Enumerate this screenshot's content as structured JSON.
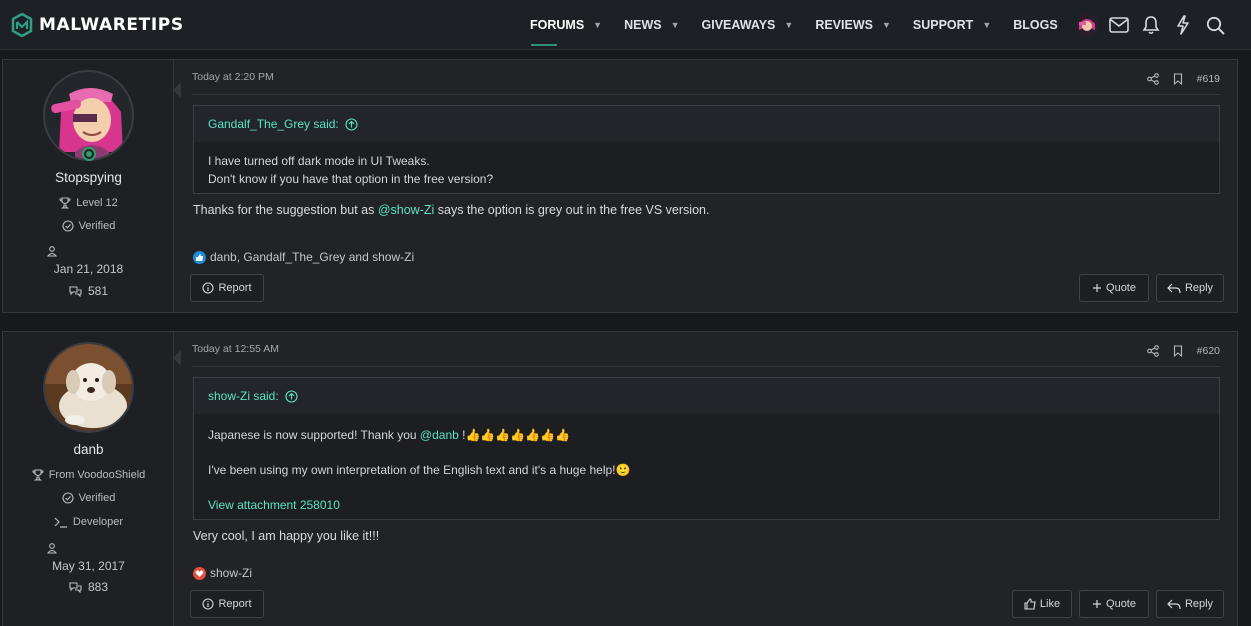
{
  "brand": {
    "name": "MALWARETIPS"
  },
  "nav": [
    {
      "label": "FORUMS",
      "has_menu": true,
      "active": true
    },
    {
      "label": "NEWS",
      "has_menu": true,
      "active": false
    },
    {
      "label": "GIVEAWAYS",
      "has_menu": true,
      "active": false
    },
    {
      "label": "REVIEWS",
      "has_menu": true,
      "active": false
    },
    {
      "label": "SUPPORT",
      "has_menu": true,
      "active": false
    },
    {
      "label": "BLOGS",
      "has_menu": false,
      "active": false
    }
  ],
  "top_icons": [
    "user-avatar",
    "envelope-icon",
    "bell-icon",
    "bolt-icon",
    "search-icon"
  ],
  "colors": {
    "accent": "#5de3c2",
    "brand": "#2f8f7a",
    "online": "#2f9f6a",
    "like": "#1b8fd6",
    "love": "#e0513d"
  },
  "posts": [
    {
      "user": {
        "name": "Stopspying",
        "badges": [
          {
            "icon": "trophy-icon",
            "label": "Level 12"
          },
          {
            "icon": "check-circle-icon",
            "label": "Verified"
          }
        ],
        "joined": "Jan 21, 2018",
        "messages": "581",
        "online": true
      },
      "date": "Today at 2:20 PM",
      "number": "#619",
      "quote": {
        "author_said": "Gandalf_The_Grey said:",
        "lines": [
          "I have turned off dark mode in UI Tweaks.",
          "Don't know if you have that option in the free version?"
        ]
      },
      "text_before": "Thanks for the suggestion but as ",
      "mention": "@show-Zi",
      "text_after": " says the option is grey out in the free VS version.",
      "reactions": "danb, Gandalf_The_Grey and show-Zi",
      "buttons": {
        "report": "Report",
        "quote": "Quote",
        "reply": "Reply"
      }
    },
    {
      "user": {
        "name": "danb",
        "badges": [
          {
            "icon": "trophy-icon",
            "label": "From VoodooShield"
          },
          {
            "icon": "check-circle-icon",
            "label": "Verified"
          },
          {
            "icon": "terminal-icon",
            "label": "Developer"
          }
        ],
        "joined": "May 31, 2017",
        "messages": "883",
        "online": false
      },
      "date": "Today at 12:55 AM",
      "number": "#620",
      "quote": {
        "author_said": "show-Zi said:",
        "line1_before": "Japanese is now supported! Thank you ",
        "line1_mention": "@danb",
        "line1_after": " !",
        "line1_emoji": "👍👍👍👍👍👍👍",
        "line2": "I've been using my own interpretation of the English text and it's a huge help!",
        "line2_emoji": "🙂",
        "attachment": "View attachment 258010"
      },
      "text": "Very cool, I am happy you like it!!!",
      "reactions": "show-Zi",
      "buttons": {
        "report": "Report",
        "like": "Like",
        "quote": "Quote",
        "reply": "Reply"
      }
    }
  ]
}
